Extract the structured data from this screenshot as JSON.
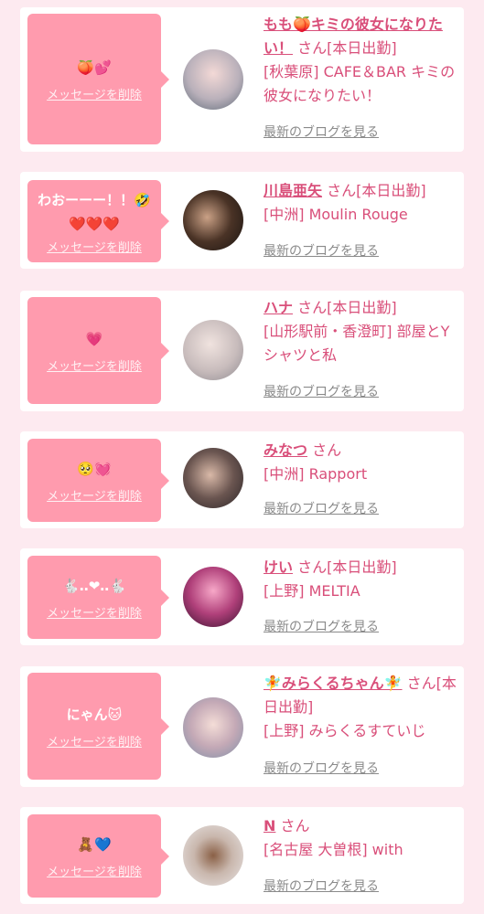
{
  "delete_label": "メッセージを削除",
  "blog_label": "最新のブログを見る",
  "san_label": "さん",
  "cards": [
    {
      "message": "🍑💕",
      "name": "もも🍑キミの彼女になりたい！",
      "status": "[本日出勤]",
      "shop": "[秋葉原] CAFE＆BAR キミの彼女になりたい！"
    },
    {
      "message": "わおーーー！！🤣\n❤️❤️❤️",
      "name": "川島亜矢",
      "status": "[本日出勤]",
      "shop": "[中洲] Moulin Rouge"
    },
    {
      "message": "💗",
      "name": "ハナ",
      "status": "[本日出勤]",
      "shop": "[山形駅前・香澄町] 部屋とYシャツと私"
    },
    {
      "message": "🥺💓",
      "name": "みなつ",
      "status": "",
      "shop": "[中洲] Rapport"
    },
    {
      "message": "🐇‥❤︎‥🐇",
      "name": "けい",
      "status": "[本日出勤]",
      "shop": "[上野] MELTIA"
    },
    {
      "message": "にゃん🐱",
      "name": "🧚みらくるちゃん🧚",
      "status": "[本日出勤]",
      "shop": "[上野] みらくるすていじ"
    },
    {
      "message": "🧸💙",
      "name": "N",
      "status": "",
      "shop": "[名古屋 大曽根] with"
    }
  ]
}
